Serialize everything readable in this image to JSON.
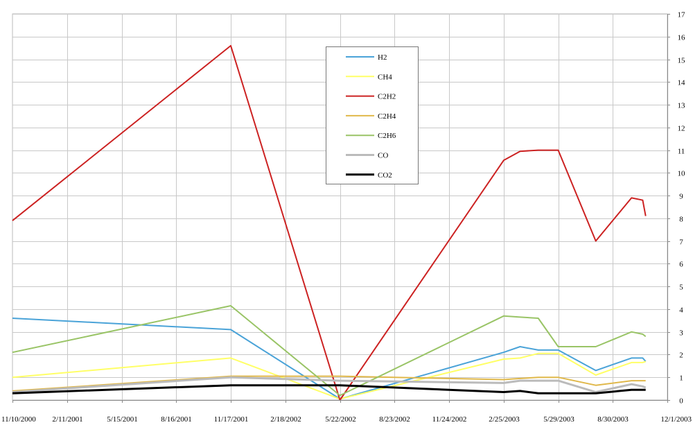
{
  "chart_data": {
    "type": "line",
    "title": "",
    "xlabel": "",
    "ylabel": "",
    "ylim": [
      0,
      17
    ],
    "y_axis_side": "right",
    "yticks": [
      0,
      1,
      2,
      3,
      4,
      5,
      6,
      7,
      8,
      9,
      10,
      11,
      12,
      13,
      14,
      15,
      16,
      17
    ],
    "x_tick_labels": [
      "11/10/2000",
      "2/11/2001",
      "5/15/2001",
      "8/16/2001",
      "11/17/2001",
      "2/18/2002",
      "5/22/2002",
      "8/23/2002",
      "11/24/2002",
      "2/25/2003",
      "5/29/2003",
      "8/30/2003",
      "12/1/2003"
    ],
    "grid": true,
    "legend_position": "top-center",
    "x": [
      "11/10/2000",
      "11/17/2001",
      "5/22/2002",
      "2/25/2003",
      "3/25/2003",
      "4/25/2003",
      "5/29/2003",
      "8/1/2003",
      "10/1/2003",
      "10/20/2003",
      "10/25/2003"
    ],
    "series": [
      {
        "name": "H2",
        "color": "#4aa3d8",
        "width": 2,
        "values": [
          3.6,
          3.1,
          0.05,
          2.1,
          2.35,
          2.2,
          2.2,
          1.3,
          1.85,
          1.85,
          1.7
        ]
      },
      {
        "name": "CH4",
        "color": "#ffff66",
        "width": 2,
        "values": [
          1.0,
          1.85,
          0.05,
          1.8,
          1.85,
          2.05,
          2.05,
          1.1,
          1.65,
          1.65,
          1.7
        ]
      },
      {
        "name": "C2H2",
        "color": "#cc2222",
        "width": 2,
        "values": [
          7.9,
          15.6,
          0.0,
          10.55,
          10.95,
          11.0,
          11.0,
          7.0,
          8.9,
          8.8,
          8.1
        ]
      },
      {
        "name": "C2H4",
        "color": "#e0b84a",
        "width": 2,
        "values": [
          0.4,
          1.05,
          1.05,
          0.9,
          0.95,
          1.0,
          1.0,
          0.65,
          0.85,
          0.85,
          0.85
        ]
      },
      {
        "name": "C2H6",
        "color": "#99c466",
        "width": 2,
        "values": [
          2.1,
          4.15,
          0.2,
          3.7,
          3.65,
          3.6,
          2.35,
          2.35,
          3.0,
          2.9,
          2.8
        ]
      },
      {
        "name": "CO",
        "color": "#bbbbbb",
        "width": 3,
        "values": [
          0.35,
          1.0,
          0.85,
          0.75,
          0.85,
          0.85,
          0.85,
          0.35,
          0.7,
          0.6,
          0.55
        ]
      },
      {
        "name": "CO2",
        "color": "#000000",
        "width": 3,
        "values": [
          0.3,
          0.65,
          0.65,
          0.35,
          0.4,
          0.3,
          0.3,
          0.3,
          0.45,
          0.45,
          0.45
        ]
      }
    ]
  }
}
